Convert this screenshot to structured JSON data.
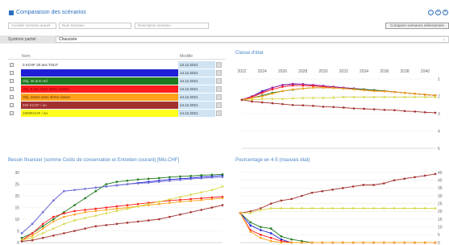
{
  "window": {
    "title": "Comparaison des scénarios",
    "controls": [
      "−",
      "+",
      "×"
    ]
  },
  "toolbar": {
    "current_scenario_placeholder": "Accéder scénario actuel",
    "name_placeholder": "Nom scénario",
    "description_placeholder": "Description scénario",
    "compare_button": "Comparer scénarios sélectionnés"
  },
  "filter": {
    "label": "Système partiel",
    "value": "Chaussée"
  },
  "grid": {
    "col_name": "Nom",
    "col_modified": "Modifié",
    "rows": [
      {
        "name": "0 KCHF 20 ans TOUT",
        "date": "13.12.2021",
        "color": "#ffffff",
        "text_color": "#333333",
        "checked": true
      },
      {
        "name": "",
        "date": "14.12.2021",
        "color": "#1f1fd6",
        "text_color": "#ffffff",
        "checked": true
      },
      {
        "name": "Obj. 40 ans red",
        "date": "14.12.2021",
        "color": "#1e7a1e",
        "text_color": "#e6e6e6",
        "checked": true
      },
      {
        "name": "Obj. 5 ans sans 3ème classe",
        "date": "14.12.2021",
        "color": "#ff1c1c",
        "text_color": "#7a0000",
        "checked": true
      },
      {
        "name": "Obj. 10ans sans 3ème classe",
        "date": "14.12.2021",
        "color": "#ffa11c",
        "text_color": "#5a3300",
        "checked": true
      },
      {
        "name": "500 KCHF / an",
        "date": "14.12.2021",
        "color": "#a2302e",
        "text_color": "#e8c0c0",
        "checked": true
      },
      {
        "name": "1000KCHF / an",
        "date": "14.12.2021",
        "color": "#ffff1e",
        "text_color": "#555500",
        "checked": true
      }
    ]
  },
  "chart_data": [
    {
      "type": "line",
      "title": "Classe d'état",
      "xlabel": "",
      "ylabel": "",
      "x_ticks": [
        "2022",
        "2024",
        "2026",
        "2028",
        "2030",
        "2032",
        "2034",
        "2036",
        "2038",
        "2040"
      ],
      "y_ticks": [
        "1",
        "2",
        "3",
        "4",
        "5"
      ],
      "ylim": [
        1,
        5
      ],
      "y_axis": "right",
      "y_inverted": true,
      "x": [
        2022,
        2023,
        2024,
        2025,
        2026,
        2027,
        2028,
        2029,
        2030,
        2031,
        2032,
        2033,
        2034,
        2035,
        2036,
        2037,
        2038,
        2039,
        2040,
        2041
      ],
      "series": [
        {
          "color": "#1f1fd6",
          "values": [
            2.2,
            2.0,
            1.7,
            1.5,
            1.35,
            1.3,
            1.3,
            1.35,
            1.4,
            1.45,
            1.5,
            1.55,
            1.6,
            1.65,
            1.7,
            1.75,
            1.8,
            1.85,
            1.9,
            1.95
          ]
        },
        {
          "color": "#a01a9a",
          "values": [
            2.2,
            2.0,
            1.75,
            1.5,
            1.35,
            1.28,
            1.3,
            1.35,
            1.4,
            1.45,
            1.5,
            1.55,
            1.6,
            1.65,
            1.7,
            1.75,
            1.8,
            1.85,
            1.9,
            1.95
          ]
        },
        {
          "color": "#ff1c1c",
          "values": [
            2.2,
            2.05,
            1.8,
            1.6,
            1.45,
            1.38,
            1.38,
            1.4,
            1.45,
            1.5,
            1.55,
            1.58,
            1.62,
            1.65,
            1.7,
            1.75,
            1.8,
            1.85,
            1.9,
            1.95
          ]
        },
        {
          "color": "#1e7a1e",
          "values": [
            2.2,
            2.1,
            1.95,
            1.8,
            1.7,
            1.62,
            1.55,
            1.5,
            1.5,
            1.52,
            1.55,
            1.58,
            1.6,
            1.65,
            1.7,
            1.75,
            1.8,
            1.85,
            1.9,
            1.95
          ]
        },
        {
          "color": "#ffa11c",
          "values": [
            2.2,
            2.1,
            2.0,
            1.85,
            1.7,
            1.6,
            1.55,
            1.5,
            1.5,
            1.52,
            1.55,
            1.6,
            1.65,
            1.7,
            1.72,
            1.75,
            1.8,
            1.85,
            1.9,
            1.95
          ]
        },
        {
          "color": "#d8d84a",
          "values": [
            2.2,
            2.2,
            2.15,
            2.15,
            2.15,
            2.12,
            2.1,
            2.1,
            2.1,
            2.08,
            2.05,
            2.05,
            2.05,
            2.05,
            2.05,
            2.05,
            2.05,
            2.05,
            2.05,
            2.05
          ]
        },
        {
          "color": "#a2302e",
          "values": [
            2.2,
            2.3,
            2.35,
            2.4,
            2.45,
            2.5,
            2.52,
            2.55,
            2.6,
            2.62,
            2.65,
            2.7,
            2.72,
            2.75,
            2.78,
            2.8,
            2.85,
            2.88,
            2.92,
            2.95
          ]
        }
      ]
    },
    {
      "type": "line",
      "title": "Besoin financier (somme Coûts de conservation et Entretien courant) [Mio.CHF]",
      "xlabel": "",
      "ylabel": "",
      "y_ticks": [
        "0",
        "5",
        "10",
        "15",
        "20",
        "25",
        "30"
      ],
      "ylim": [
        0,
        30
      ],
      "y_axis": "left",
      "x": [
        2022,
        2023,
        2024,
        2025,
        2026,
        2027,
        2028,
        2029,
        2030,
        2031,
        2032,
        2033,
        2034,
        2035,
        2036,
        2037,
        2038,
        2039,
        2040,
        2041
      ],
      "series": [
        {
          "color": "#1f1fd6",
          "values": [
            4,
            8,
            13,
            18,
            22,
            22.5,
            23,
            23.5,
            24,
            24.5,
            25,
            25.5,
            26,
            26.5,
            27,
            27.3,
            27.6,
            28,
            28.3,
            28.7
          ]
        },
        {
          "color": "#7a7ad6",
          "values": [
            4,
            8,
            13,
            18,
            22,
            22.5,
            23,
            23.5,
            24,
            24.5,
            25,
            25.3,
            25.6,
            26,
            26.4,
            26.8,
            27.2,
            27.5,
            27.8,
            28
          ]
        },
        {
          "color": "#1e7a1e",
          "values": [
            2,
            4,
            7,
            10,
            13,
            16,
            19,
            22,
            25,
            26,
            26.5,
            27,
            27.3,
            27.6,
            28,
            28.3,
            28.5,
            28.8,
            29,
            29.2
          ]
        },
        {
          "color": "#ff1c1c",
          "values": [
            1,
            4,
            8,
            11,
            12.5,
            13.5,
            14,
            14.5,
            15,
            15.5,
            16,
            16.5,
            17,
            17.5,
            18,
            18.3,
            18.6,
            19,
            19.3,
            19.6
          ]
        },
        {
          "color": "#ffa11c",
          "values": [
            1,
            3,
            6,
            9,
            11,
            12,
            13,
            13.5,
            14,
            14.5,
            15,
            15.5,
            16,
            16.5,
            17,
            17.5,
            17.8,
            18.2,
            18.6,
            19
          ]
        },
        {
          "color": "#d8d84a",
          "values": [
            1,
            2,
            4,
            6,
            8,
            9.5,
            10.5,
            11.5,
            12.5,
            13.5,
            14.5,
            15.5,
            16.5,
            17.5,
            18.5,
            19.5,
            20.5,
            21.5,
            22.5,
            24
          ]
        },
        {
          "color": "#a2302e",
          "values": [
            0.5,
            1,
            2,
            3,
            4,
            5,
            6,
            7,
            7.5,
            8,
            8.5,
            9,
            9.5,
            10,
            11,
            12,
            13,
            14,
            15,
            16
          ]
        }
      ]
    },
    {
      "type": "line",
      "title": "Pourcentage en 4-5 (mauvais état)",
      "xlabel": "",
      "ylabel": "",
      "y_ticks": [
        "0",
        "5",
        "10",
        "15",
        "20",
        "25",
        "30",
        "35",
        "40",
        "45"
      ],
      "ylim": [
        0,
        45
      ],
      "y_axis": "right",
      "x": [
        2022,
        2023,
        2024,
        2025,
        2026,
        2027,
        2028,
        2029,
        2030,
        2031,
        2032,
        2033,
        2034,
        2035,
        2036,
        2037,
        2038,
        2039,
        2040,
        2041
      ],
      "series": [
        {
          "color": "#a2302e",
          "values": [
            19,
            20,
            22,
            25,
            27,
            28,
            30,
            32,
            33,
            34,
            35,
            36,
            37,
            37,
            38,
            40,
            41,
            42,
            43,
            44
          ]
        },
        {
          "color": "#d8d84a",
          "values": [
            19,
            19,
            21,
            22,
            22,
            22,
            22,
            22,
            22,
            22,
            22,
            22,
            22,
            22,
            22,
            22,
            22,
            22,
            22,
            22
          ]
        },
        {
          "color": "#1e7a1e",
          "values": [
            19,
            13,
            10,
            9,
            4,
            2,
            1,
            0,
            0,
            0,
            0,
            0,
            0,
            0,
            0,
            0,
            0,
            0,
            0,
            0
          ]
        },
        {
          "color": "#1f1fd6",
          "values": [
            19,
            11,
            8,
            6,
            2,
            0,
            0,
            0,
            0,
            0,
            0,
            0,
            0,
            0,
            0,
            0,
            0,
            0,
            0,
            0
          ]
        },
        {
          "color": "#ff1c1c",
          "values": [
            19,
            8,
            5,
            3,
            1,
            0,
            0,
            0,
            0,
            0,
            0,
            0,
            0,
            0,
            0,
            0,
            0,
            0,
            0,
            0
          ]
        },
        {
          "color": "#ffa11c",
          "values": [
            19,
            7,
            3,
            1,
            0,
            0,
            0,
            0,
            0,
            0,
            0,
            0,
            0,
            0,
            0,
            0,
            0,
            0,
            0,
            0
          ]
        }
      ]
    }
  ]
}
